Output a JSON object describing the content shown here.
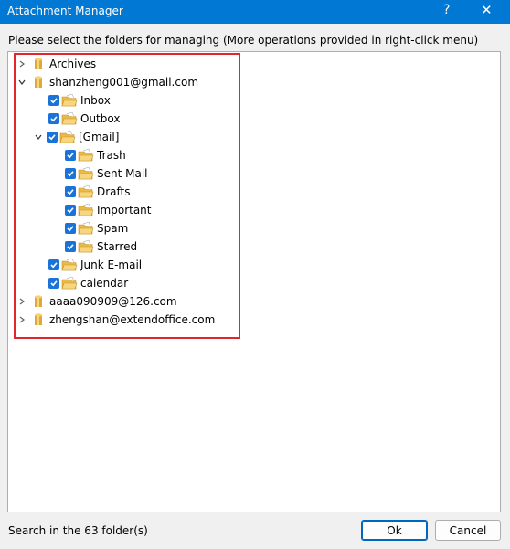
{
  "window": {
    "title": "Attachment Manager",
    "help_label": "?",
    "close_label": "✕"
  },
  "instruction": "Please select the folders for managing (More operations provided in right-click menu)",
  "tree": [
    {
      "label": "Archives",
      "icon": "database-icon",
      "expanded": false,
      "checkbox": false
    },
    {
      "label": "shanzheng001@gmail.com",
      "icon": "database-icon",
      "expanded": true,
      "checkbox": false
    },
    {
      "label": "Inbox",
      "icon": "folder-icon",
      "checkbox": true
    },
    {
      "label": "Outbox",
      "icon": "folder-icon",
      "checkbox": true
    },
    {
      "label": "[Gmail]",
      "icon": "folder-icon",
      "expanded": true,
      "checkbox": true
    },
    {
      "label": "Trash",
      "icon": "folder-icon",
      "checkbox": true
    },
    {
      "label": "Sent Mail",
      "icon": "folder-icon",
      "checkbox": true
    },
    {
      "label": "Drafts",
      "icon": "folder-icon",
      "checkbox": true
    },
    {
      "label": "Important",
      "icon": "folder-icon",
      "checkbox": true
    },
    {
      "label": "Spam",
      "icon": "folder-icon",
      "checkbox": true
    },
    {
      "label": "Starred",
      "icon": "folder-icon",
      "checkbox": true
    },
    {
      "label": "Junk E-mail",
      "icon": "folder-icon",
      "checkbox": true
    },
    {
      "label": "calendar",
      "icon": "folder-icon",
      "checkbox": true
    },
    {
      "label": "aaaa090909@126.com",
      "icon": "database-icon",
      "expanded": false,
      "checkbox": false
    },
    {
      "label": "zhengshan@extendoffice.com",
      "icon": "database-icon",
      "expanded": false,
      "checkbox": false
    }
  ],
  "status": "Search in the 63 folder(s)",
  "buttons": {
    "ok": "Ok",
    "cancel": "Cancel"
  },
  "colors": {
    "titlebar": "#0078d4",
    "checkbox": "#1a73d8",
    "highlight_border": "#e3262e",
    "folder": "#f2c450"
  }
}
